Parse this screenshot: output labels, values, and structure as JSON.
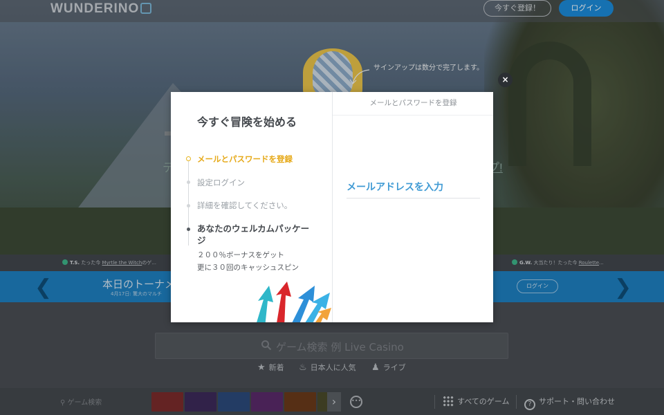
{
  "header": {
    "logo": "WUNDERINO",
    "signup_button": "今すぐ登録！",
    "login_button": "ログイン"
  },
  "hero": {
    "tooltip": "サインアップは数分で完了します。",
    "ghost_left": "デ",
    "ghost_right": "プ!"
  },
  "ticker": {
    "items": [
      {
        "user": "T.S.",
        "text": "たった今",
        "game": "Myrtle the Witch",
        "suffix": "のゲ..."
      },
      {
        "user": "G.W.",
        "text": "大当たり！たった今",
        "game": "Roulette",
        "suffix": "..."
      }
    ]
  },
  "tournament": {
    "title": "本日のトーナメ",
    "subtitle": "4月17日: 驚大のマルチ",
    "login_button": "ログイン"
  },
  "search": {
    "placeholder": "ゲーム検索 例 Live Casino"
  },
  "categories": [
    {
      "icon": "star-icon",
      "label": "新着"
    },
    {
      "icon": "flame-icon",
      "label": "日本人に人気"
    },
    {
      "icon": "person-icon",
      "label": "ライブ"
    }
  ],
  "bottom_bar": {
    "search_placeholder": "ゲーム検索",
    "all_games": "すべてのゲーム",
    "support": "サポート・問い合わせ",
    "thumb_colors": [
      "#7a2b2b",
      "#3c2a5a",
      "#2b4a7a",
      "#5a2a6a",
      "#6a3a1a",
      "#4a4a2a"
    ]
  },
  "modal": {
    "title": "今すぐ冒険を始める",
    "steps": [
      {
        "label": "メールとパスワードを登録",
        "state": "active"
      },
      {
        "label": "設定ログイン",
        "state": "inactive"
      },
      {
        "label": "詳細を確認してください。",
        "state": "inactive"
      },
      {
        "label": "あなたのウェルカムパッケージ",
        "state": "final"
      }
    ],
    "bonus_lines": [
      "２００％ボーナスをゲット",
      "更に３０回のキャッシュスピン"
    ],
    "right_header": "メールとパスワードを登録",
    "email_label": "メールアドレスを入力",
    "close": "×"
  },
  "colors": {
    "accent_blue": "#1b8ad8",
    "step_active": "#e6a918",
    "email_label": "#3f9ad4"
  }
}
